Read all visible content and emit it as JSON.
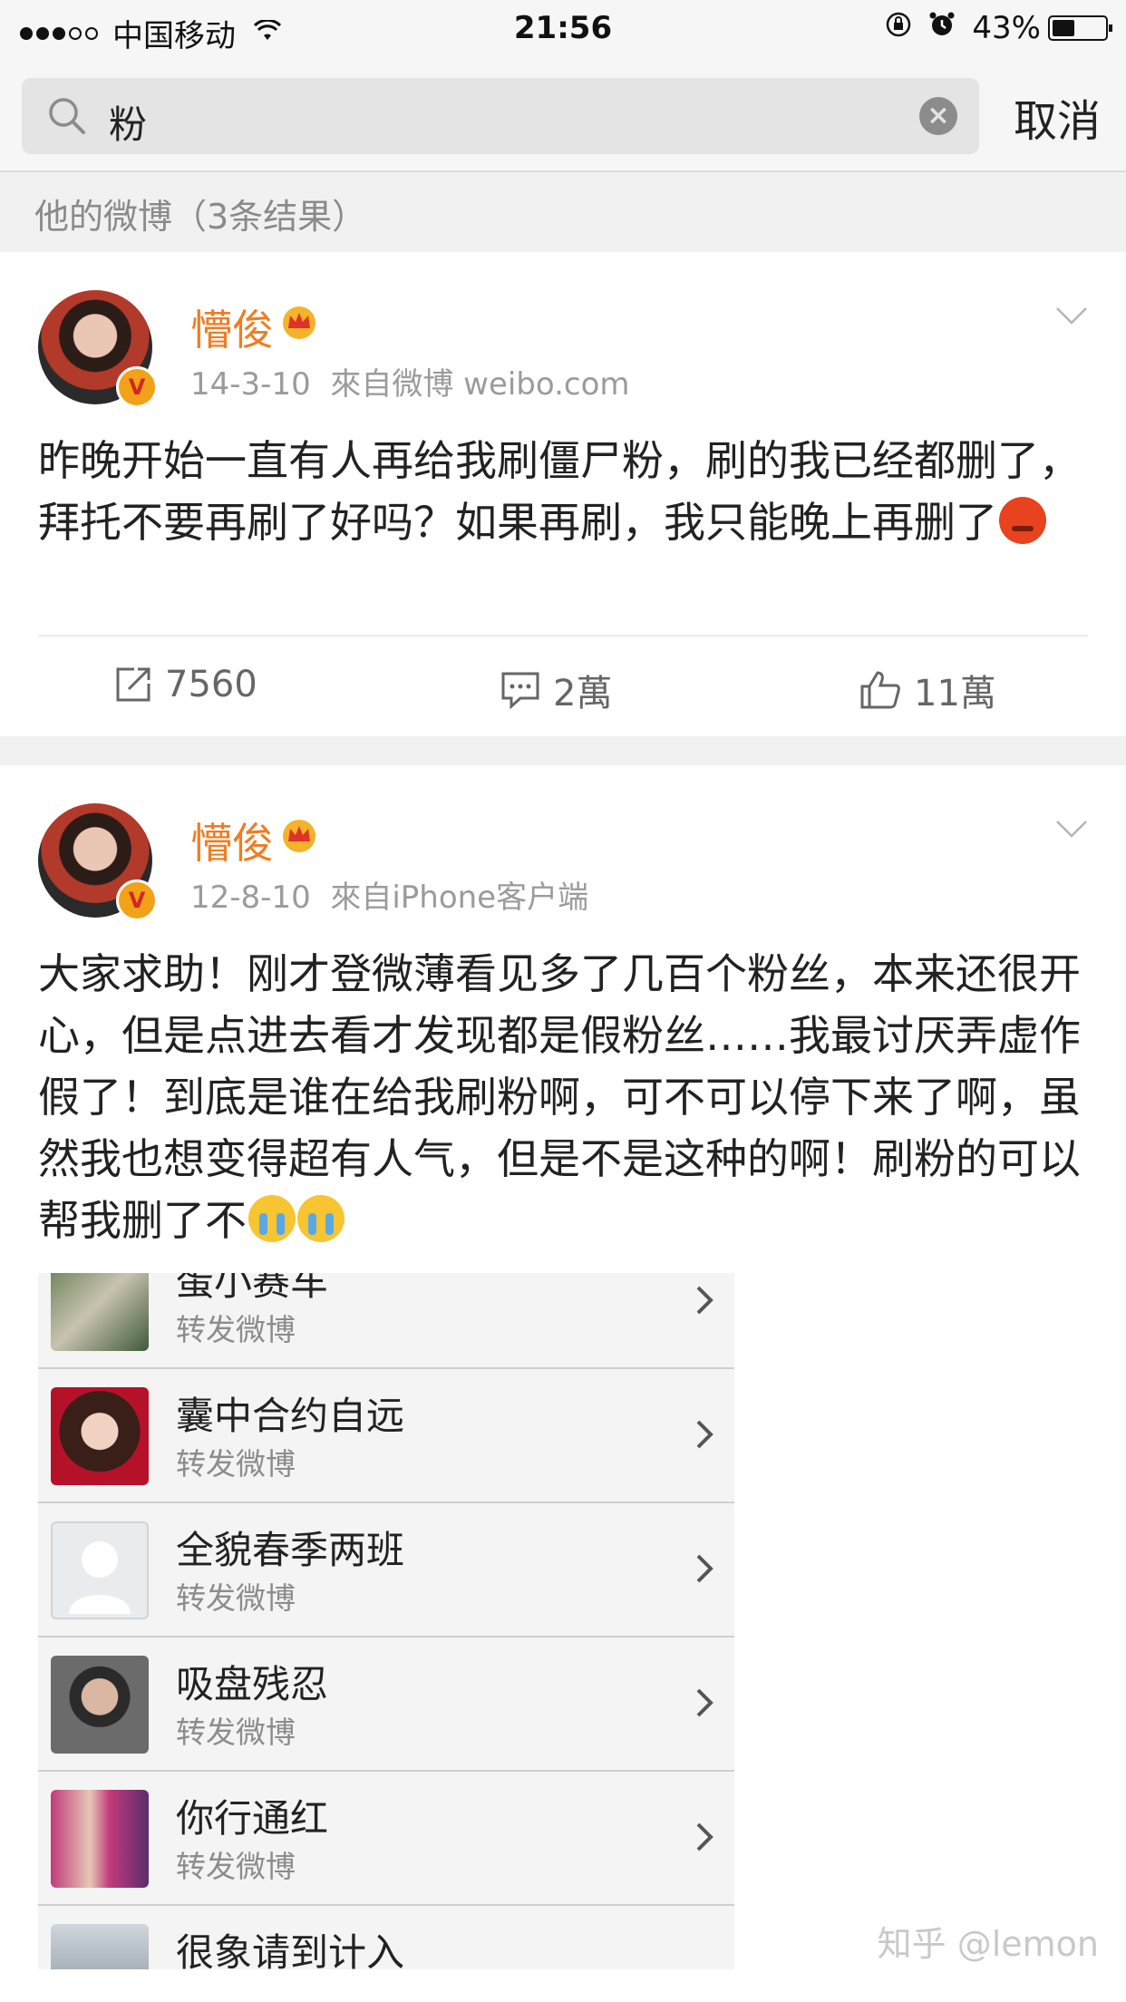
{
  "status_bar": {
    "carrier": "中国移动",
    "time": "21:56",
    "battery_text": "43%",
    "battery_level": 0.43,
    "signal_dots_full": 3,
    "signal_dots_total": 5
  },
  "search": {
    "query": "粉",
    "cancel_label": "取消"
  },
  "results_header": "他的微博（3条结果）",
  "posts": [
    {
      "username": "懵俊",
      "date": "14-3-10",
      "source": "來自微博 weibo.com",
      "text": "昨晚开始一直有人再给我刷僵尸粉，刷的我已经都删了，拜托不要再刷了好吗？如果再刷，我只能晚上再删了",
      "emoji": "angry-face-icon",
      "reposts": "7560",
      "comments": "2萬",
      "likes": "11萬"
    },
    {
      "username": "懵俊",
      "date": "12-8-10",
      "source": "來自iPhone客户端",
      "text": "大家求助！刚才登微薄看见多了几百个粉丝，本来还很开心，但是点进去看才发现都是假粉丝……我最讨厌弄虚作假了！到底是谁在给我刷粉啊，可不可以停下来了啊，虽然我也想变得超有人气，但是不是这种的啊！刷粉的可以帮我删了不",
      "emoji": "crying-face-icon"
    }
  ],
  "embedded_list": [
    {
      "name": "蛋小赛车",
      "subtitle": "转发微博"
    },
    {
      "name": "囊中合约自远",
      "subtitle": "转发微博"
    },
    {
      "name": "全貌春季两班",
      "subtitle": "转发微博"
    },
    {
      "name": "吸盘残忍",
      "subtitle": "转发微博"
    },
    {
      "name": "你行通红",
      "subtitle": "转发微博"
    },
    {
      "name": "很象请到计入",
      "subtitle": ""
    }
  ],
  "watermark": "知乎 @lemon",
  "colors": {
    "username": "#f07c22",
    "verified_badge": "#f2a218",
    "background_gray": "#f1f1f1"
  }
}
